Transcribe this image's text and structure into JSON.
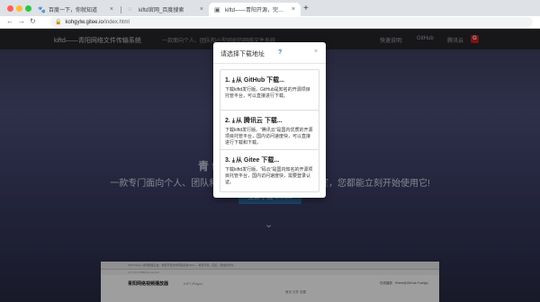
{
  "browser": {
    "tabs": [
      {
        "title": "百度一下，你就知道",
        "icon": "paw-icon",
        "active": false
      },
      {
        "title": "kiftd官网_百度搜索",
        "icon": "loading-icon",
        "active": false
      },
      {
        "title": "kiftd——青阳开源，完善，便捷的文...",
        "icon": "page-icon",
        "active": true
      }
    ],
    "new_tab_symbol": "+",
    "url_host": "kohgylw.gitee.io",
    "url_path": "/index.html"
  },
  "site": {
    "brand": "kiftd——青阳网络文件传输系统",
    "nav_tagline": "一款面向个人、团队和小型组织的网络文件系统",
    "nav_right_label": "快速说明:",
    "nav_github": "GitHub",
    "nav_tencent": "腾讯云",
    "nav_gitee_symbol": "G",
    "hero_title": "青 ftd",
    "hero_subtitle": "一款专门面向个人、团队和小型组织的私                                            还是在办公室，您都能立刻开始使用它!",
    "download_button": "立即下载 1.0.23",
    "scroll_symbol": "⌄"
  },
  "preview": {
    "tabbar": "KIFT-Player          青阳网络云盘 - 青阳开源文件传输系统          kiftd — 青阳开源，完善，便捷的文件...",
    "addr": "127.0.0.1:8080/home.html",
    "heading": "青阳网络视频播放器",
    "heading_sub": "KIFT-Player",
    "right": "在线播放 · Sheet@GitHub Foreign",
    "nav": "首页    文件    设置"
  },
  "modal": {
    "title": "请选择下载地址",
    "help": "?",
    "close": "×",
    "options": [
      {
        "num": "1.",
        "name": "从 GitHub 下载...",
        "desc": "下载kiftd发行版。GitHub是知名的开源项目托管平台，可以直接进行下载。"
      },
      {
        "num": "2.",
        "name": "从 腾讯云 下载...",
        "desc": "下载kiftd发行版。“腾讯云”是国内优质的开源项目托管平台，国内访问速度快，可以直接进行下载和下载。"
      },
      {
        "num": "3.",
        "name": "从 Gitee 下载...",
        "desc": "下载kiftd发行版。“码云”是国内知名的开源项目托管平台，国内访问速度快，需要登录认证。"
      }
    ]
  }
}
